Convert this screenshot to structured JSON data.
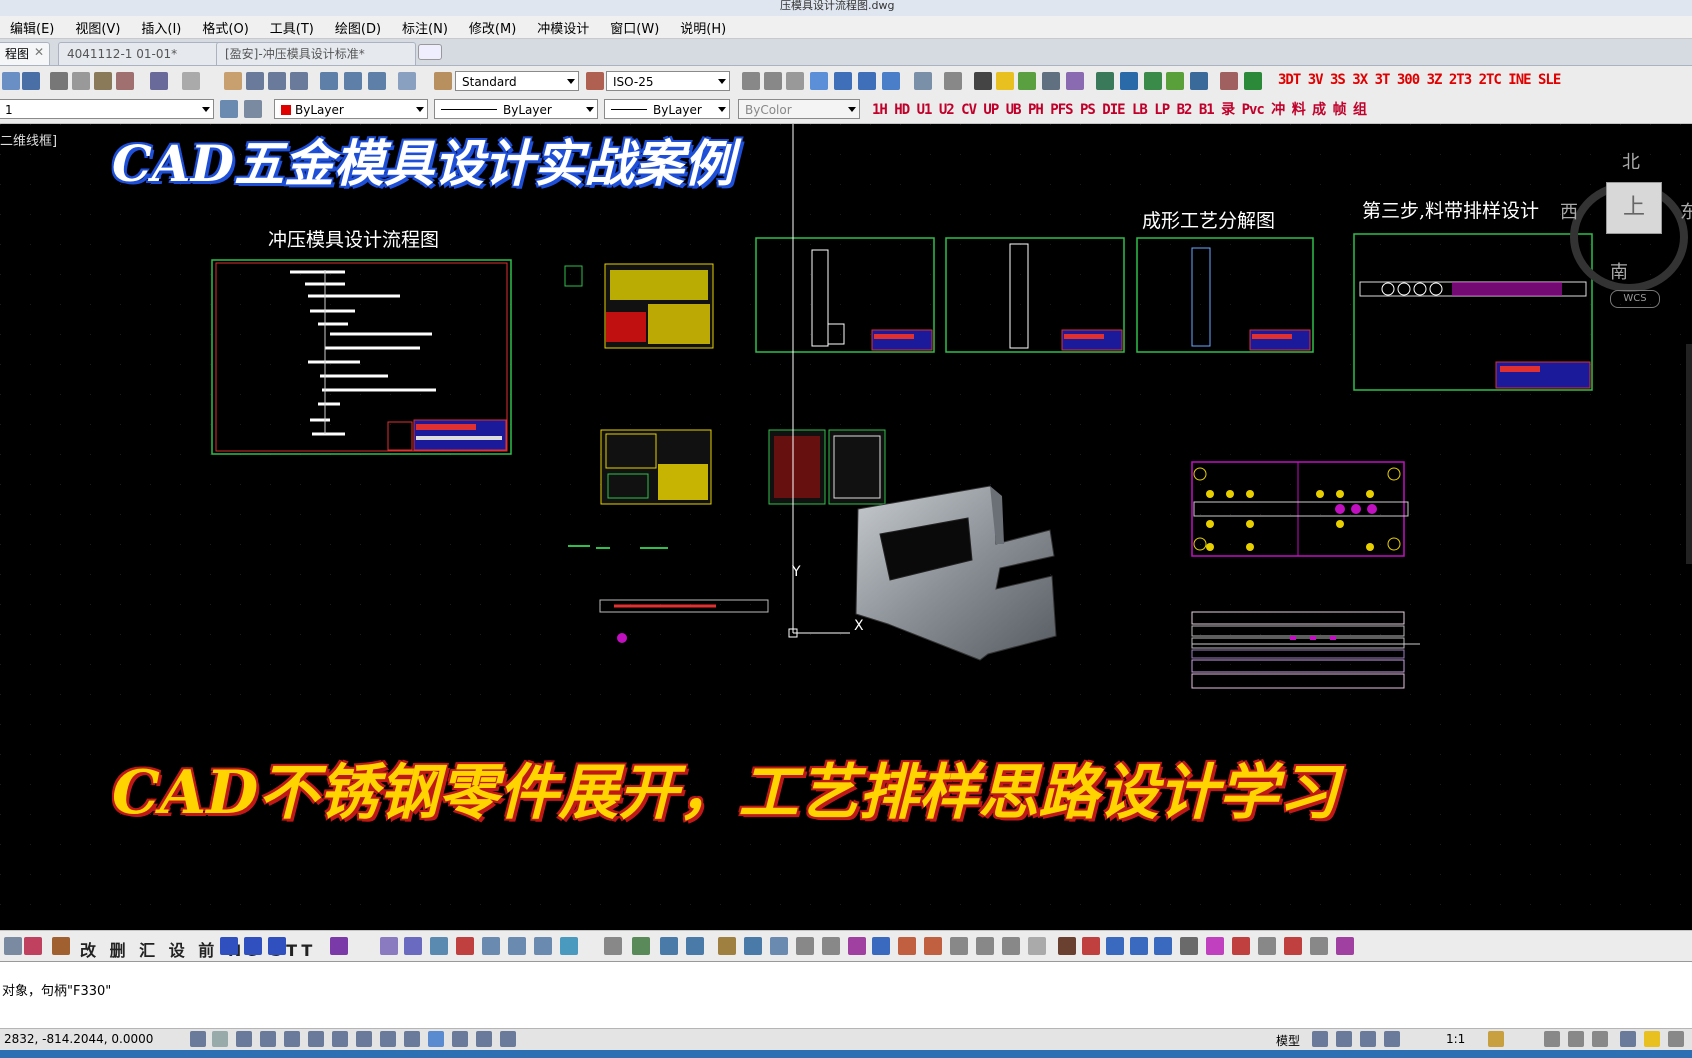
{
  "window": {
    "title_fragment": "压模具设计流程图.dwg"
  },
  "menu": [
    "编辑(E)",
    "视图(V)",
    "插入(I)",
    "格式(O)",
    "工具(T)",
    "绘图(D)",
    "标注(N)",
    "修改(M)",
    "冲模设计",
    "窗口(W)",
    "说明(H)"
  ],
  "tabs": [
    {
      "label": "程图"
    },
    {
      "label": "4041112-1 01-01*"
    },
    {
      "label": "[盈安]-冲压模具设计标准*"
    }
  ],
  "toolbar1": {
    "text_style": "Standard",
    "dim_style": "ISO-25",
    "custom_commands": "3DT 3V 3S 3X 3T 300 3Z 2T3 2TC INE SLE"
  },
  "toolbar2": {
    "layer": "1",
    "color": "ByLayer",
    "linetype": "ByLayer",
    "lineweight": "ByLayer",
    "plot_style": "ByColor",
    "custom_commands": "1H HD U1 U2 CV UP UB PH PFS PS DIE LB LP B2 B1 录 Pvc 冲 料 成 帧 组"
  },
  "viewport_label": "二维线框]",
  "viewcube": {
    "north": "北",
    "south": "南",
    "west": "西",
    "east": "东",
    "top": "上",
    "wcs": "WCS"
  },
  "overlay": {
    "headline": "CAD五金模具设计实战案例",
    "footer": "CAD不锈钢零件展开，工艺排样思路设计学习"
  },
  "drawing": {
    "flowchart_title": "冲压模具设计流程图",
    "forming_title": "成形工艺分解图",
    "strip_title": "第三步,料带排样设计",
    "ucs_y": "Y",
    "ucs_x": "X"
  },
  "bottom_toolbar": {
    "text_labels": "改 删 汇 设 前 NC STT"
  },
  "command_line": {
    "text": "对象，句柄\"F330\""
  },
  "status": {
    "coords": "2832,   -814.2044,  0.0000",
    "model": "模型",
    "scale": "1:1"
  },
  "colors": {
    "frame_green": "#2fbf4a",
    "frame_red": "#e03030",
    "headline": "#ffffff",
    "footer": "#ffd400"
  }
}
